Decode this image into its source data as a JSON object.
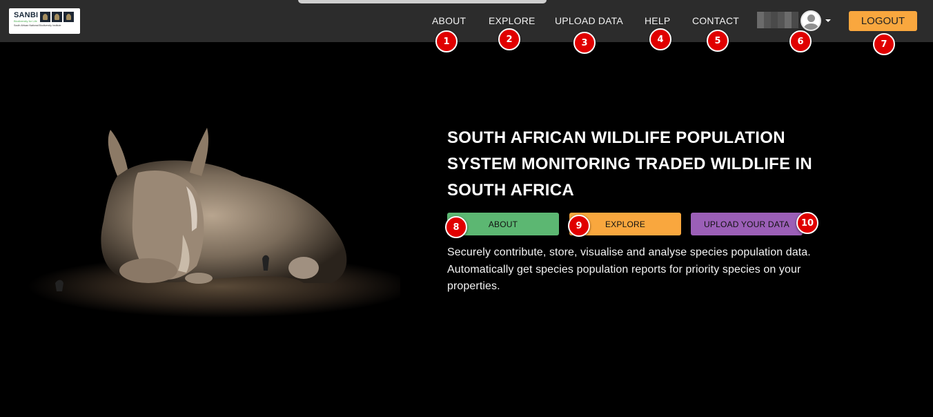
{
  "brand": {
    "logo_title": "SANBI",
    "logo_tagline": "Biodiversity for Life",
    "logo_subtitle": "South African National Biodiversity Institute"
  },
  "nav": {
    "items": [
      {
        "label": "ABOUT"
      },
      {
        "label": "EXPLORE"
      },
      {
        "label": "UPLOAD DATA"
      },
      {
        "label": "HELP"
      },
      {
        "label": "CONTACT"
      }
    ],
    "logout_label": "LOGOUT"
  },
  "markers": [
    "1",
    "2",
    "3",
    "4",
    "5",
    "6",
    "7",
    "8",
    "9",
    "10"
  ],
  "hero": {
    "title": "SOUTH AFRICAN WILDLIFE POPULATION SYSTEM MONITORING TRADED WILDLIFE IN SOUTH AFRICA",
    "buttons": {
      "about": "ABOUT",
      "explore": "EXPLORE",
      "upload": "UPLOAD YOUR DATA"
    },
    "description": "Securely contribute, store, visualise and analyse species population data. Automatically get species population reports for priority species on your properties."
  },
  "colors": {
    "navbar": "#2c2c2c",
    "background": "#000000",
    "accent_orange": "#f9a73e",
    "accent_green": "#5cb772",
    "accent_purple": "#9b5fb7",
    "marker_red": "#e00000"
  }
}
